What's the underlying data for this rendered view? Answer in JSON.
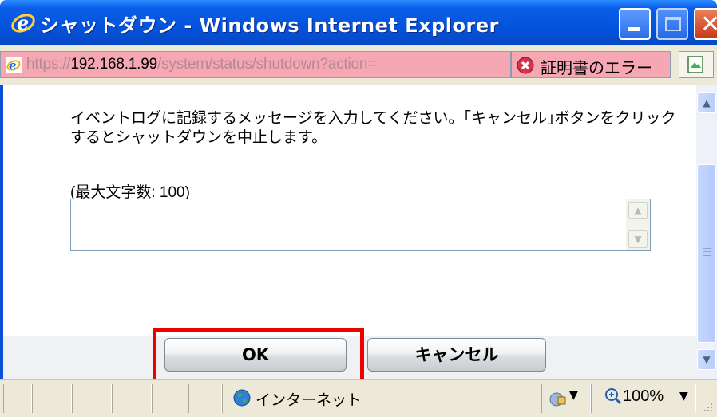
{
  "window": {
    "title": "シャットダウン - Windows Internet Explorer",
    "icons": {
      "app": "ie-icon",
      "minimize": "minimize-icon",
      "maximize": "maximize-icon",
      "close": "close-icon"
    }
  },
  "address_bar": {
    "url_scheme": "https://",
    "url_host": "192.168.1.99",
    "url_path": "/system/status/shutdown?action=",
    "cert_error_label": "証明書のエラー",
    "cert_icon": "shield-error-icon",
    "page_icon": "page-icon",
    "background_color": "#f6a7b4"
  },
  "content": {
    "message": "イベントログに記録するメッセージを入力してください。｢キャンセル｣ボタンをクリックするとシャットダウンを中止します。",
    "max_chars_label": "(最大文字数: 100)",
    "textarea_value": ""
  },
  "buttons": {
    "ok": "OK",
    "cancel": "キャンセル",
    "highlight_color": "#ee0000"
  },
  "status_bar": {
    "zone": "インターネット",
    "zone_icon": "globe-icon",
    "protected_mode_icon": "protected-mode-icon",
    "zoom": "100%",
    "zoom_icon": "zoom-icon"
  }
}
